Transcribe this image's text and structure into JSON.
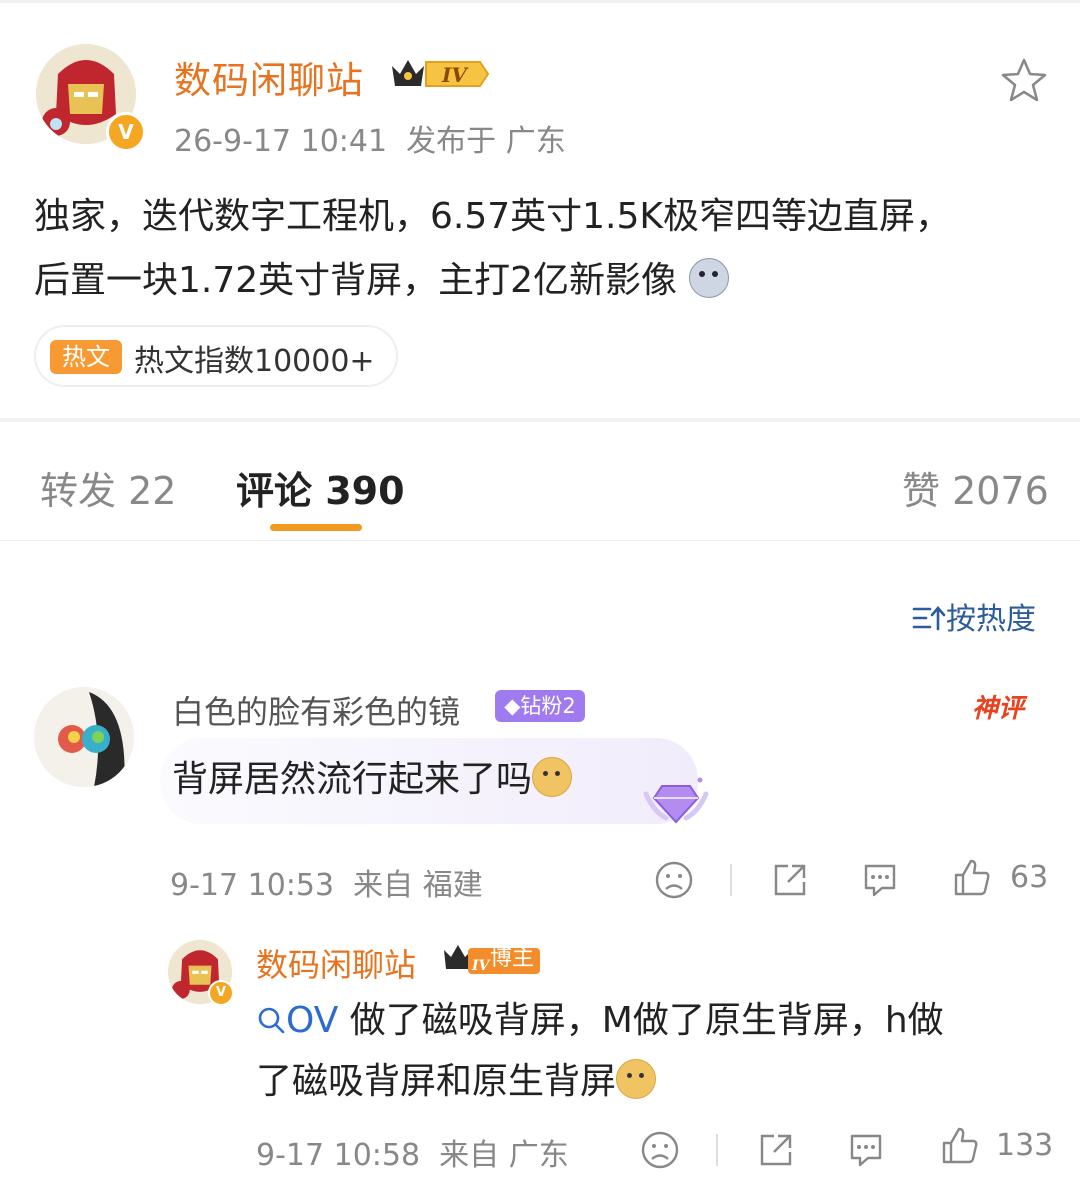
{
  "post": {
    "author": "数码闲聊站",
    "level_badge": "IV",
    "verified_mark": "V",
    "time": "26-9-17 10:41",
    "location": "发布于 广东",
    "content_line1": "独家，迭代数字工程机，6.57英寸1.5K极窄四等边直屏，",
    "content_line2": "后置一块1.72英寸背屏，主打2亿新影像",
    "hot_tag": "热文",
    "hot_index": "热文指数10000+"
  },
  "tabs": {
    "repost": "转发 22",
    "comment": "评论 390",
    "like": "赞 2076"
  },
  "sort_label": "按热度",
  "comment": {
    "name": "白色的脸有彩色的镜",
    "fan_badge": "钻粉2",
    "tag": "神评",
    "text": "背屏居然流行起来了吗",
    "time": "9-17 10:53",
    "location": "来自 福建",
    "likes": "63"
  },
  "reply": {
    "name": "数码闲聊站",
    "level_badge": "IV",
    "role": "博主",
    "link": "OV",
    "text1": " 做了磁吸背屏，M做了原生背屏，h做",
    "text2": "了磁吸背屏和原生背屏",
    "time": "9-17 10:58",
    "location": "来自 广东",
    "likes": "133"
  },
  "icons": {
    "star": "star-outline-icon",
    "sort": "sort-icon",
    "search": "search-icon",
    "dislike": "frown-icon",
    "share": "share-icon",
    "comment": "comment-icon",
    "like": "thumbs-up-icon"
  },
  "colors": {
    "author": "#e8731f",
    "tab_underline": "#f29a1f",
    "link": "#2c6ccf",
    "sort": "#2c5c9b",
    "fan_badge": "#a07bf0",
    "hot_tag": "#f79a33"
  }
}
